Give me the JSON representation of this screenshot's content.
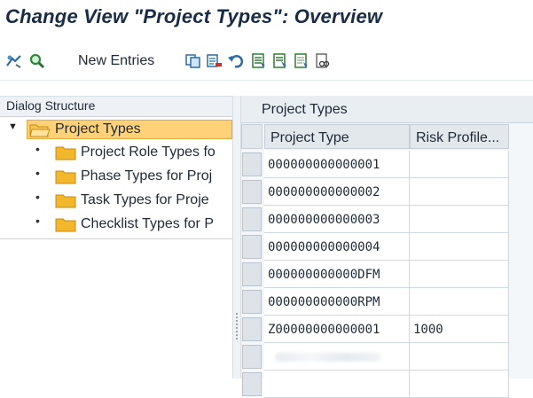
{
  "title": "Change View \"Project Types\": Overview",
  "toolbar": {
    "new_entries_label": "New Entries",
    "icons": [
      "display-change-icon",
      "find-icon",
      "copy-icon",
      "delete-icon",
      "undo-icon",
      "select-all-icon",
      "select-block-icon",
      "deselect-all-icon",
      "details-icon"
    ]
  },
  "dialog_structure": {
    "header": "Dialog Structure",
    "items": [
      {
        "label": "Project Types",
        "selected": true,
        "expanded": true
      },
      {
        "label": "Project Role Types fo"
      },
      {
        "label": "Phase Types for Proj"
      },
      {
        "label": "Task Types for Proje"
      },
      {
        "label": "Checklist Types for P"
      }
    ]
  },
  "table": {
    "title": "Project Types",
    "columns": [
      "Project Type",
      "Risk Profile..."
    ],
    "rows": [
      {
        "project_type": "000000000000001",
        "risk_profile": ""
      },
      {
        "project_type": "000000000000002",
        "risk_profile": ""
      },
      {
        "project_type": "000000000000003",
        "risk_profile": ""
      },
      {
        "project_type": "000000000000004",
        "risk_profile": ""
      },
      {
        "project_type": "000000000000DFM",
        "risk_profile": ""
      },
      {
        "project_type": "000000000000RPM",
        "risk_profile": ""
      },
      {
        "project_type": "Z00000000000001",
        "risk_profile": "1000"
      },
      {
        "project_type": "",
        "risk_profile": ""
      },
      {
        "project_type": "",
        "risk_profile": ""
      }
    ]
  },
  "colors": {
    "title_text": "#1a2b45",
    "selection_fill": "#ffd27a",
    "folder_yellow": "#f2b72a",
    "header_bg": "#e9eef3"
  }
}
